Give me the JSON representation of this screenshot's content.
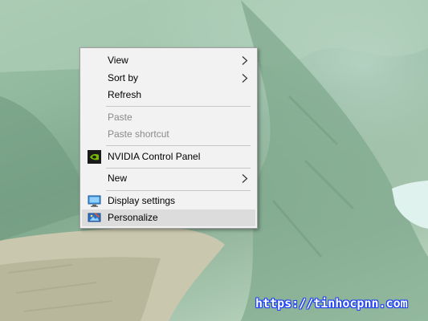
{
  "context_menu": {
    "items": [
      {
        "label": "View",
        "submenu": true,
        "disabled": false
      },
      {
        "label": "Sort by",
        "submenu": true,
        "disabled": false
      },
      {
        "label": "Refresh",
        "submenu": false,
        "disabled": false
      },
      {
        "label": "Paste",
        "submenu": false,
        "disabled": true
      },
      {
        "label": "Paste shortcut",
        "submenu": false,
        "disabled": true
      },
      {
        "label": "NVIDIA Control Panel",
        "icon": "nvidia-icon",
        "disabled": false
      },
      {
        "label": "New",
        "submenu": true,
        "disabled": false
      },
      {
        "label": "Display settings",
        "icon": "display-icon",
        "disabled": false
      },
      {
        "label": "Personalize",
        "icon": "personalize-icon",
        "disabled": false,
        "highlighted": true
      }
    ]
  },
  "watermark": {
    "text": "https://tinhocpnn.com"
  },
  "colors": {
    "menu_bg": "#f2f2f2",
    "highlight_bg": "#dcdcdc",
    "disabled_text": "#8a8a8a",
    "nvidia_green": "#76b900",
    "watermark_outline": "#1a3cff"
  }
}
